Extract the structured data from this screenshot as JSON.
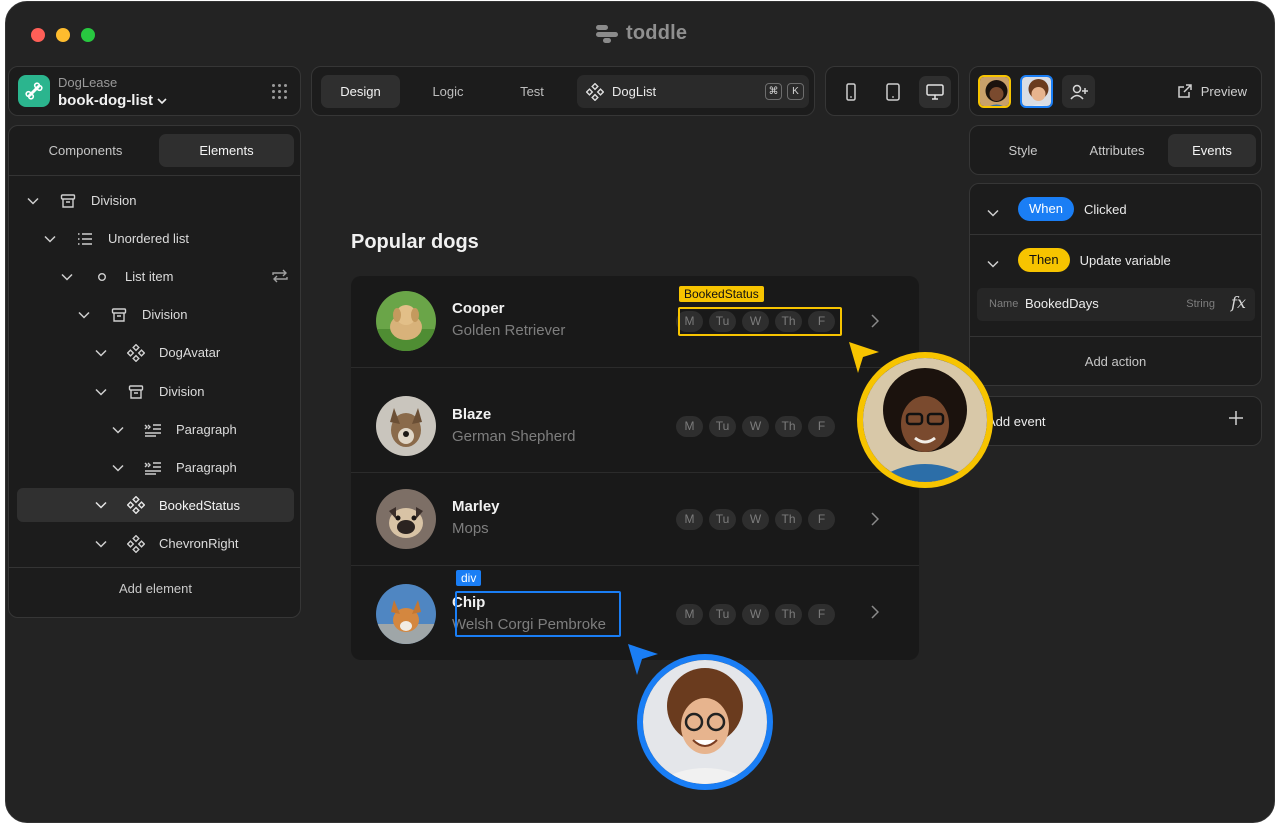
{
  "app": {
    "brand": "toddle"
  },
  "colors": {
    "window": "#232323",
    "panel": "#1c1c1c",
    "accent_yellow": "#f7c400",
    "accent_blue": "#1a7ef5",
    "logo_green": "#2bb58e"
  },
  "project": {
    "org": "DogLease",
    "name": "book-dog-list",
    "icon": "bone-icon"
  },
  "modes": {
    "tabs": [
      {
        "label": "Design",
        "active": true
      },
      {
        "label": "Logic",
        "active": false
      },
      {
        "label": "Test",
        "active": false
      }
    ],
    "component": {
      "label": "DogList",
      "shortcut": [
        "⌘",
        "K"
      ]
    }
  },
  "devices": [
    "phone-icon",
    "tablet-icon",
    "desktop-icon"
  ],
  "collab": {
    "preview": "Preview"
  },
  "left_panel": {
    "tabs": [
      {
        "label": "Components",
        "active": false
      },
      {
        "label": "Elements",
        "active": true
      }
    ],
    "tree": [
      {
        "label": "Division",
        "icon": "box-icon"
      },
      {
        "label": "Unordered list",
        "icon": "list-icon"
      },
      {
        "label": "List item",
        "icon": "circle-icon"
      },
      {
        "label": "Division",
        "icon": "box-icon"
      },
      {
        "label": "DogAvatar",
        "icon": "component-icon"
      },
      {
        "label": "Division",
        "icon": "box-icon"
      },
      {
        "label": "Paragraph",
        "icon": "paragraph-icon"
      },
      {
        "label": "Paragraph",
        "icon": "paragraph-icon"
      },
      {
        "label": "BookedStatus",
        "icon": "component-icon",
        "selected": true
      },
      {
        "label": "ChevronRight",
        "icon": "component-icon"
      }
    ],
    "add_element": "Add element"
  },
  "canvas": {
    "heading": "Popular dogs",
    "days": [
      "M",
      "Tu",
      "W",
      "Th",
      "F"
    ],
    "dogs": [
      {
        "name": "Cooper",
        "breed": "Golden Retriever"
      },
      {
        "name": "Blaze",
        "breed": "German Shepherd"
      },
      {
        "name": "Marley",
        "breed": "Mops"
      },
      {
        "name": "Chip",
        "breed": "Welsh Corgi Pembroke"
      }
    ],
    "tag_booked": "BookedStatus",
    "tag_div": "div"
  },
  "right_panel": {
    "tabs": [
      {
        "label": "Style",
        "active": false
      },
      {
        "label": "Attributes",
        "active": false
      },
      {
        "label": "Events",
        "active": true
      }
    ],
    "when": {
      "pill": "When",
      "text": "Clicked"
    },
    "then": {
      "pill": "Then",
      "text": "Update variable"
    },
    "field": {
      "key": "Name",
      "value": "BookedDays",
      "type": "String",
      "fx": "fx"
    },
    "add_action": "Add action",
    "add_event": "Add event"
  }
}
